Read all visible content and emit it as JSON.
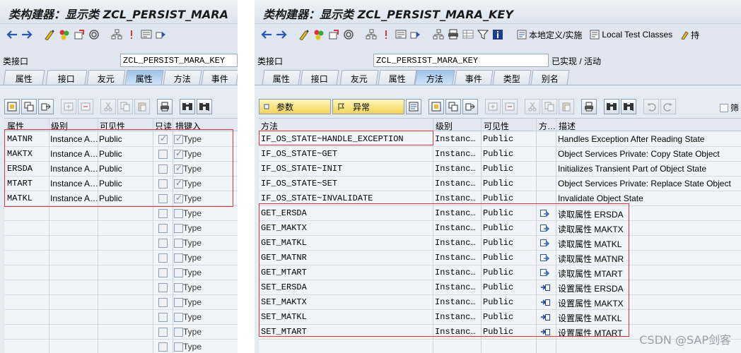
{
  "left": {
    "title": "类构建器：显示类 ZCL_PERSIST_MARA",
    "interface_label": "类接口",
    "interface_value": "ZCL_PERSIST_MARA_KEY",
    "tabs": [
      "属性",
      "接口",
      "友元",
      "属性",
      "方法",
      "事件"
    ],
    "headers": [
      "属性",
      "级别",
      "可见性",
      "只读",
      "措",
      "键入"
    ],
    "rows": [
      {
        "name": "MATNR",
        "level": "Instance A…",
        "visibility": "Public",
        "readonly": true,
        "typing": "Type"
      },
      {
        "name": "MAKTX",
        "level": "Instance A…",
        "visibility": "Public",
        "readonly": false,
        "typing": "Type"
      },
      {
        "name": "ERSDA",
        "level": "Instance A…",
        "visibility": "Public",
        "readonly": false,
        "typing": "Type"
      },
      {
        "name": "MTART",
        "level": "Instance A…",
        "visibility": "Public",
        "readonly": false,
        "typing": "Type"
      },
      {
        "name": "MATKL",
        "level": "Instance A…",
        "visibility": "Public",
        "readonly": false,
        "typing": "Type"
      }
    ],
    "empty_typing": "Type"
  },
  "right": {
    "title": "类构建器：显示类 ZCL_PERSIST_MARA_KEY",
    "toolbar_local_def": "本地定义/实施",
    "toolbar_test_classes": "Local Test Classes",
    "toolbar_more": "持",
    "interface_label": "类接口",
    "interface_value": "ZCL_PERSIST_MARA_KEY",
    "interface_status": "已实现 / 活动",
    "tabs": [
      "属性",
      "接口",
      "友元",
      "属性",
      "方法",
      "事件",
      "类型",
      "别名"
    ],
    "btn_params": "参数",
    "btn_exceptions": "异常",
    "filter_label": "筛",
    "headers": [
      "方法",
      "级别",
      "可见性",
      "方…",
      "描述"
    ],
    "rows": [
      {
        "name": "IF_OS_STATE~HANDLE_EXCEPTION",
        "level": "Instanc…",
        "visibility": "Public",
        "icon": "",
        "desc": "Handles Exception After Reading State"
      },
      {
        "name": "IF_OS_STATE~GET",
        "level": "Instanc…",
        "visibility": "Public",
        "icon": "",
        "desc": "Object Services Private: Copy State Object"
      },
      {
        "name": "IF_OS_STATE~INIT",
        "level": "Instanc…",
        "visibility": "Public",
        "icon": "",
        "desc": "Initializes Transient Part of Object State"
      },
      {
        "name": "IF_OS_STATE~SET",
        "level": "Instanc…",
        "visibility": "Public",
        "icon": "",
        "desc": "Object Services Private: Replace State Object"
      },
      {
        "name": "IF_OS_STATE~INVALIDATE",
        "level": "Instanc…",
        "visibility": "Public",
        "icon": "",
        "desc": "Invalidate Object State"
      },
      {
        "name": "GET_ERSDA",
        "level": "Instanc…",
        "visibility": "Public",
        "icon": "getter-method-icon",
        "desc": "读取属性 ERSDA"
      },
      {
        "name": "GET_MAKTX",
        "level": "Instanc…",
        "visibility": "Public",
        "icon": "getter-method-icon",
        "desc": "读取属性 MAKTX"
      },
      {
        "name": "GET_MATKL",
        "level": "Instanc…",
        "visibility": "Public",
        "icon": "getter-method-icon",
        "desc": "读取属性 MATKL"
      },
      {
        "name": "GET_MATNR",
        "level": "Instanc…",
        "visibility": "Public",
        "icon": "getter-method-icon",
        "desc": "读取属性 MATNR"
      },
      {
        "name": "GET_MTART",
        "level": "Instanc…",
        "visibility": "Public",
        "icon": "getter-method-icon",
        "desc": "读取属性 MTART"
      },
      {
        "name": "SET_ERSDA",
        "level": "Instanc…",
        "visibility": "Public",
        "icon": "setter-method-icon",
        "desc": "设置属性 ERSDA"
      },
      {
        "name": "SET_MAKTX",
        "level": "Instanc…",
        "visibility": "Public",
        "icon": "setter-method-icon",
        "desc": "设置属性 MAKTX"
      },
      {
        "name": "SET_MATKL",
        "level": "Instanc…",
        "visibility": "Public",
        "icon": "setter-method-icon",
        "desc": "设置属性 MATKL"
      },
      {
        "name": "SET_MTART",
        "level": "Instanc…",
        "visibility": "Public",
        "icon": "setter-method-icon",
        "desc": "设置属性 MTART"
      }
    ]
  },
  "watermark": "CSDN @SAP剑客",
  "colors": {
    "highlight_border": "#e0333a",
    "active_tab": "#b4d3f0",
    "grid_bg": "#f1f5fa",
    "button_yellow": "#f2d45a"
  }
}
